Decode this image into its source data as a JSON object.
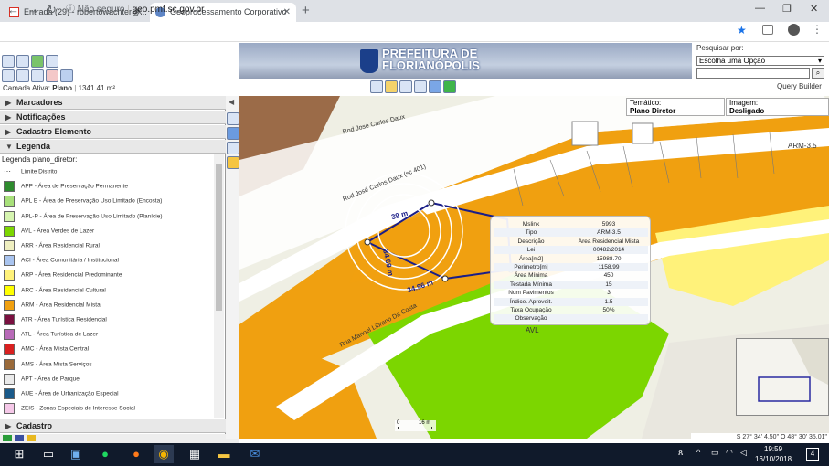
{
  "browser": {
    "tabs": [
      {
        "label": "Entrada (29) - robertowachter@..."
      },
      {
        "label": "Geoprocessamento Corporativo"
      }
    ],
    "url_security": "Não seguro",
    "url": "geo.pmf.sc.gov.br"
  },
  "app": {
    "logo_line1": "PREFEITURA DE",
    "logo_line2": "FLORIANÓPOLIS",
    "camada_label": "Camada Ativa:",
    "camada_value": "Plano",
    "camada_area": "1341.41 m²",
    "search_label": "Pesquisar por:",
    "search_option": "Escolha uma Opção",
    "query_builder": "Query Builder",
    "tematico_label": "Temático:",
    "tematico_value": "Plano Diretor",
    "imagem_label": "Imagem:",
    "imagem_value": "Desligado"
  },
  "sidebar": {
    "sections": [
      {
        "label": "Marcadores"
      },
      {
        "label": "Notificações"
      },
      {
        "label": "Cadastro Elemento"
      },
      {
        "label": "Legenda"
      }
    ],
    "bottom_section": "Cadastro",
    "legend_title": "Legenda plano_diretor:",
    "legend_items": [
      {
        "label": "Limite Distrito",
        "color": "#ffffff"
      },
      {
        "label": "APP - Área de Preservação Permanente",
        "color": "#2e8b2e"
      },
      {
        "label": "APL E - Área de Preservação Uso Limitado (Encosta)",
        "color": "#a8e07a"
      },
      {
        "label": "APL-P - Área de Preservação Uso Limitado (Planície)",
        "color": "#d6f5b0"
      },
      {
        "label": "AVL - Área Verdes de Lazer",
        "color": "#7cd600"
      },
      {
        "label": "ARR - Área Residencial Rural",
        "color": "#efefc0"
      },
      {
        "label": "ACI - Área Comunitária / Institucional",
        "color": "#a9c4ef"
      },
      {
        "label": "ARP - Área Residencial Predominante",
        "color": "#fff27a"
      },
      {
        "label": "ARC - Área Residencial Cultural",
        "color": "#ffff00"
      },
      {
        "label": "ARM - Área Residencial Mista",
        "color": "#f0a010"
      },
      {
        "label": "ATR - Área Turística Residencial",
        "color": "#7a1040"
      },
      {
        "label": "ATL - Área Turística de Lazer",
        "color": "#b86ab8"
      },
      {
        "label": "AMC - Área Mista Central",
        "color": "#d92020"
      },
      {
        "label": "AMS - Área Mista Serviços",
        "color": "#9a6a3a"
      },
      {
        "label": "APT - Área de Parque",
        "color": "#eaeaea"
      },
      {
        "label": "AUE - Área de Urbanização Especial",
        "color": "#1a5a8a"
      },
      {
        "label": "ZEIS - Zonas Especiais de Interesse Social",
        "color": "#f5c8e8"
      }
    ]
  },
  "map": {
    "streets": [
      "Rod José Carlos Daux",
      "Rod José Carlos Daux (sc 401)",
      "Rua Manoel Librano Da Costa"
    ],
    "dim_top": "39 m",
    "dim_left": "34.69 m",
    "dim_bottom": "34.96 m",
    "zone_labels": [
      "ARM-3.5",
      "AVL"
    ],
    "scale_label": "16 m",
    "coords": "S 27° 34' 4.50\" O 48° 30' 35.01\""
  },
  "info_popup": [
    {
      "k": "Mslink",
      "v": "5993"
    },
    {
      "k": "Tipo",
      "v": "ARM-3.5"
    },
    {
      "k": "Descrição",
      "v": "Área Residencial Mista"
    },
    {
      "k": "Lei",
      "v": "00482/2014"
    },
    {
      "k": "Área[m2]",
      "v": "15988.70"
    },
    {
      "k": "Perimetro[m]",
      "v": "1158.99"
    },
    {
      "k": "Área Mínima",
      "v": "450"
    },
    {
      "k": "Testada Mínima",
      "v": "15"
    },
    {
      "k": "Num Pavimentos",
      "v": "3"
    },
    {
      "k": "Índice. Aproveit.",
      "v": "1.5"
    },
    {
      "k": "Taxa Ocupação",
      "v": "50%"
    },
    {
      "k": "Observação",
      "v": ""
    }
  ],
  "taskbar": {
    "time": "19:59",
    "date": "16/10/2018",
    "notif_count": "4"
  }
}
